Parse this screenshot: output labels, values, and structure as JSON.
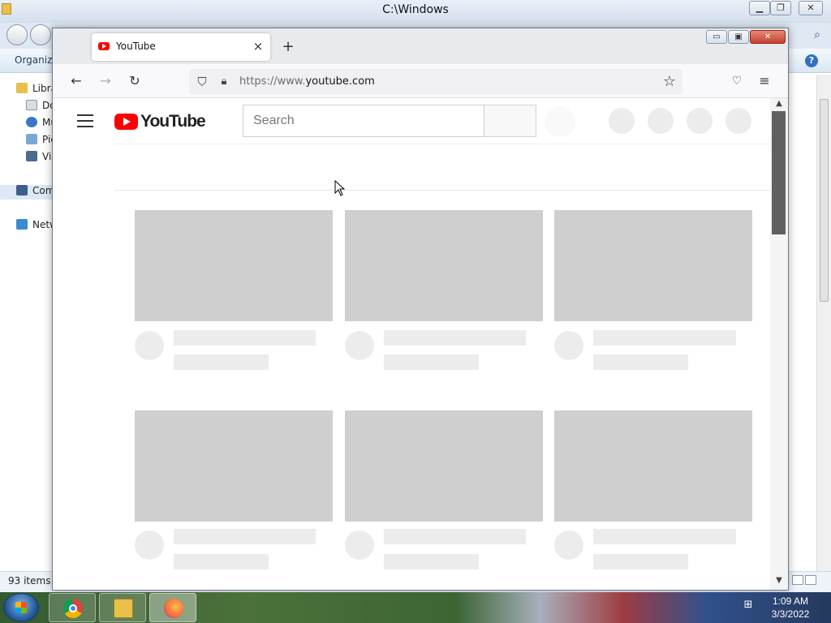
{
  "explorer": {
    "title": "C:\\Windows",
    "organize_label": "Organize",
    "nav_items": [
      {
        "label": "Libraries",
        "icon": "library-icon"
      },
      {
        "label": "Documents",
        "icon": "documents-icon"
      },
      {
        "label": "Music",
        "icon": "music-icon"
      },
      {
        "label": "Pictures",
        "icon": "pictures-icon"
      },
      {
        "label": "Videos",
        "icon": "videos-icon"
      },
      {
        "label": "Computer",
        "icon": "computer-icon"
      },
      {
        "label": "Network",
        "icon": "network-icon"
      }
    ],
    "status_items": "93 items"
  },
  "firefox": {
    "tab_title": "YouTube",
    "url_prefix": "https://www.",
    "url_domain": "youtube.com",
    "window_controls": {
      "minimize": "▭",
      "maximize": "▣",
      "close": "✕"
    }
  },
  "youtube": {
    "logo_text": "YouTube",
    "search_placeholder": "Search"
  },
  "taskbar": {
    "apps": [
      "chrome-icon",
      "file-explorer-icon",
      "firefox-icon"
    ],
    "clock_time": "1:09 AM",
    "clock_date": "3/3/2022"
  },
  "colors": {
    "youtube_red": "#ff0000",
    "skeleton_thumb": "#cfcfcf",
    "skeleton_line": "#ececec"
  }
}
